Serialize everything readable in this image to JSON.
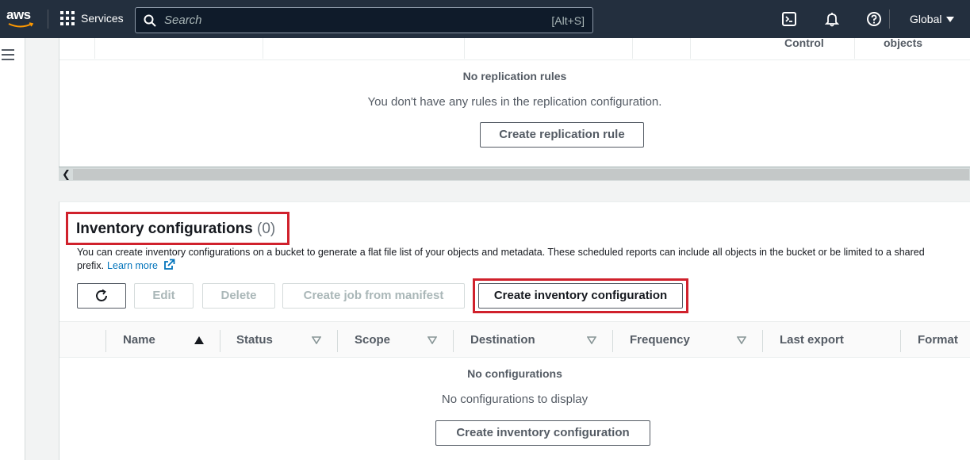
{
  "topnav": {
    "logo_text": "aws",
    "services_label": "Services",
    "search_placeholder": "Search",
    "search_shortcut": "[Alt+S]",
    "region_label": "Global"
  },
  "replication": {
    "column_headers": [
      "Control",
      "objects"
    ],
    "empty_title": "No replication rules",
    "empty_desc": "You don't have any rules in the replication configuration.",
    "create_button": "Create replication rule"
  },
  "inventory": {
    "title": "Inventory configurations",
    "count": "(0)",
    "description": "You can create inventory configurations on a bucket to generate a flat file list of your objects and metadata. These scheduled reports can include all objects in the bucket or be limited to a shared",
    "description_cont": "prefix.",
    "learn_more": "Learn more",
    "toolbar": {
      "edit": "Edit",
      "delete": "Delete",
      "create_job": "Create job from manifest",
      "create_config": "Create inventory configuration"
    },
    "columns": [
      "Name",
      "Status",
      "Scope",
      "Destination",
      "Frequency",
      "Last export",
      "Format"
    ],
    "empty_title": "No configurations",
    "empty_desc": "No configurations to display",
    "empty_create_button": "Create inventory configuration"
  },
  "colors": {
    "nav_bg": "#232f3e",
    "highlight_red": "#d0212c",
    "link_blue": "#0073bb"
  }
}
